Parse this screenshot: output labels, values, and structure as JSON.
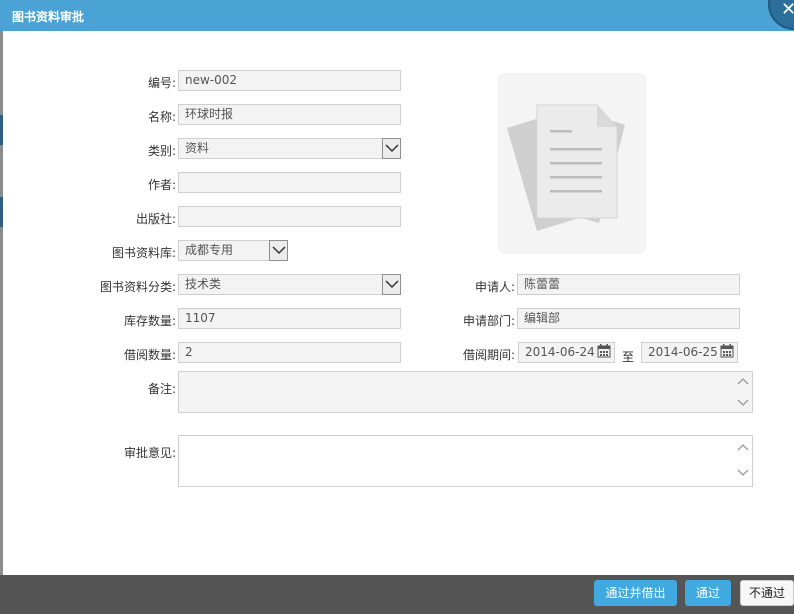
{
  "window": {
    "title": "图书资料审批"
  },
  "form": {
    "number": {
      "label": "编号:",
      "value": "new-002"
    },
    "name": {
      "label": "名称:",
      "value": "环球时报"
    },
    "category": {
      "label": "类别:",
      "value": "资料"
    },
    "author": {
      "label": "作者:",
      "value": ""
    },
    "publisher": {
      "label": "出版社:",
      "value": ""
    },
    "library": {
      "label": "图书资料库:",
      "value": "成都专用"
    },
    "classification": {
      "label": "图书资料分类:",
      "value": "技术类"
    },
    "stock": {
      "label": "库存数量:",
      "value": "1107"
    },
    "borrow_qty": {
      "label": "借阅数量:",
      "value": "2"
    },
    "applicant": {
      "label": "申请人:",
      "value": "陈蕾蕾"
    },
    "department": {
      "label": "申请部门:",
      "value": "编辑部"
    },
    "period": {
      "label": "借阅期间:",
      "start": "2014-06-24",
      "to": "至",
      "end": "2014-06-25"
    },
    "remarks": {
      "label": "备注:",
      "value": ""
    },
    "opinion": {
      "label": "审批意见:",
      "value": ""
    }
  },
  "buttons": {
    "approve_and_lend": "通过并借出",
    "approve": "通过",
    "reject": "不通过"
  },
  "icons": {
    "close": "close-icon",
    "document": "document-icon",
    "calendar": "calendar-icon",
    "dropdown": "chevron-down-icon"
  },
  "colors": {
    "title_bar": "#4aa3d4",
    "primary_button": "#3fa9e0",
    "footer": "#555555"
  }
}
